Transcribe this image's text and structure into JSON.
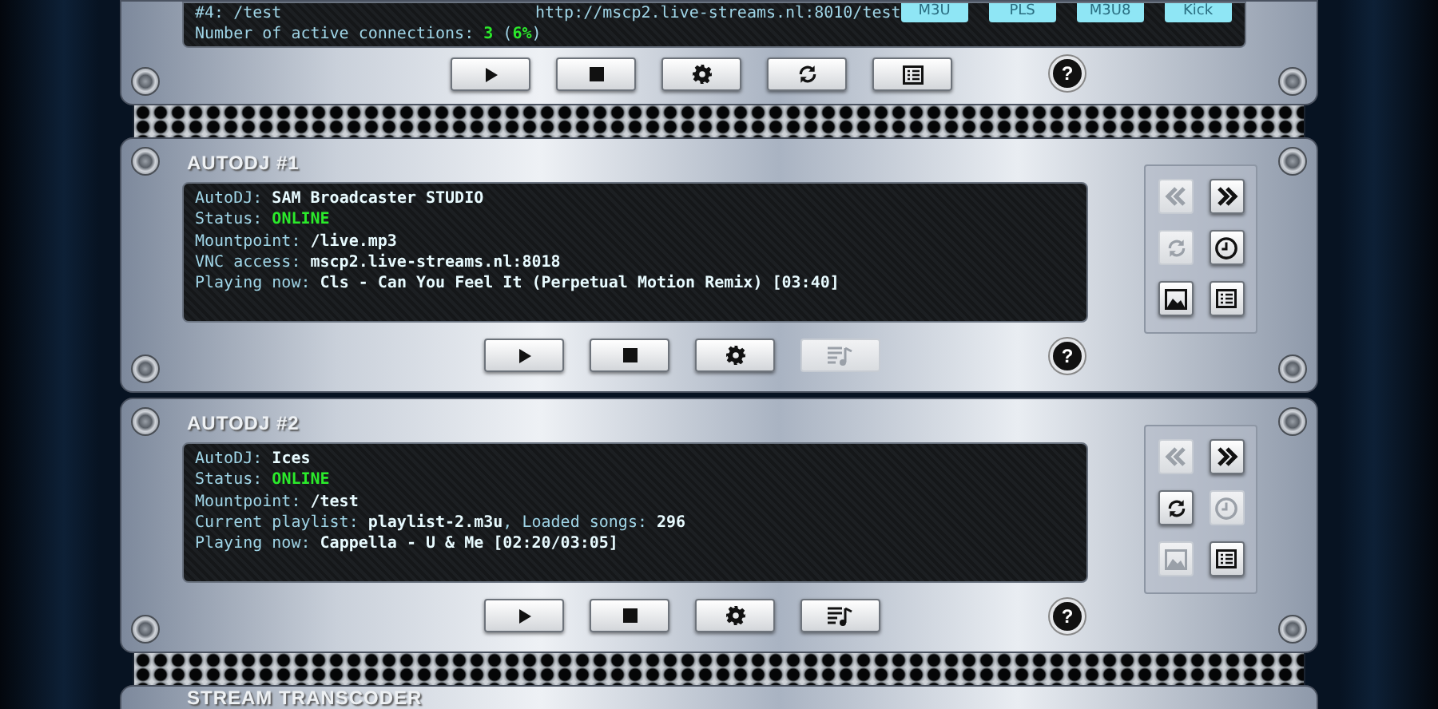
{
  "top_panel": {
    "lines": [
      {
        "kind": "mount",
        "mount": "#4: /test",
        "url": "http://mscp2.live-streams.nl:8010/test"
      },
      {
        "kind": "status",
        "text": "Number of active connections: **3** (**6%**)"
      }
    ],
    "playlist_links": [
      "M3U",
      "PLS",
      "M3U8",
      "Kick"
    ],
    "buttons": [
      {
        "kind": "play",
        "disabled": false
      },
      {
        "kind": "stop",
        "disabled": false
      },
      {
        "kind": "gear",
        "disabled": false
      },
      {
        "kind": "refresh",
        "disabled": false
      },
      {
        "kind": "list",
        "disabled": false
      }
    ],
    "help_label": "?"
  },
  "autodj_panels": [
    {
      "title": "AUTODJ #1",
      "lines": [
        {
          "kind": "plain",
          "text": "AutoDJ: **SAM Broadcaster STUDIO**"
        },
        {
          "kind": "status",
          "text": "Status: **ONLINE**"
        },
        {
          "kind": "plain",
          "text": "Mountpoint: **/live.mp3**"
        },
        {
          "kind": "plain",
          "text": "VNC access: **mscp2.live-streams.nl:8018**"
        },
        {
          "kind": "plain",
          "text": "Playing now: **Cls - Can You Feel It (Perpetual Motion Remix) [03:40]**"
        }
      ],
      "buttons": [
        {
          "kind": "play",
          "disabled": false
        },
        {
          "kind": "stop",
          "disabled": false
        },
        {
          "kind": "gear",
          "disabled": false
        },
        {
          "kind": "playlist",
          "disabled": true
        }
      ],
      "help_label": "?",
      "side_buttons": [
        {
          "kind": "rewind",
          "disabled": true
        },
        {
          "kind": "forward",
          "disabled": false
        },
        {
          "kind": "refresh",
          "disabled": true
        },
        {
          "kind": "clock",
          "disabled": false
        },
        {
          "kind": "picture",
          "disabled": false
        },
        {
          "kind": "list",
          "disabled": false
        }
      ]
    },
    {
      "title": "AUTODJ #2",
      "lines": [
        {
          "kind": "plain",
          "text": "AutoDJ: **Ices**"
        },
        {
          "kind": "status",
          "text": "Status: **ONLINE**"
        },
        {
          "kind": "plain",
          "text": "Mountpoint: **/test**"
        },
        {
          "kind": "plain",
          "text": "Current playlist: **playlist-2.m3u**, Loaded songs: **296**"
        },
        {
          "kind": "plain",
          "text": "Playing now: **Cappella - U & Me [02:20/03:05]**"
        }
      ],
      "buttons": [
        {
          "kind": "play",
          "disabled": false
        },
        {
          "kind": "stop",
          "disabled": false
        },
        {
          "kind": "gear",
          "disabled": false
        },
        {
          "kind": "playlist",
          "disabled": false
        }
      ],
      "help_label": "?",
      "side_buttons": [
        {
          "kind": "rewind",
          "disabled": true
        },
        {
          "kind": "forward",
          "disabled": false
        },
        {
          "kind": "refresh",
          "disabled": false
        },
        {
          "kind": "clock",
          "disabled": true
        },
        {
          "kind": "picture",
          "disabled": true
        },
        {
          "kind": "list",
          "disabled": false
        }
      ]
    }
  ],
  "bottom_panel": {
    "title": "STREAM TRANSCODER"
  }
}
